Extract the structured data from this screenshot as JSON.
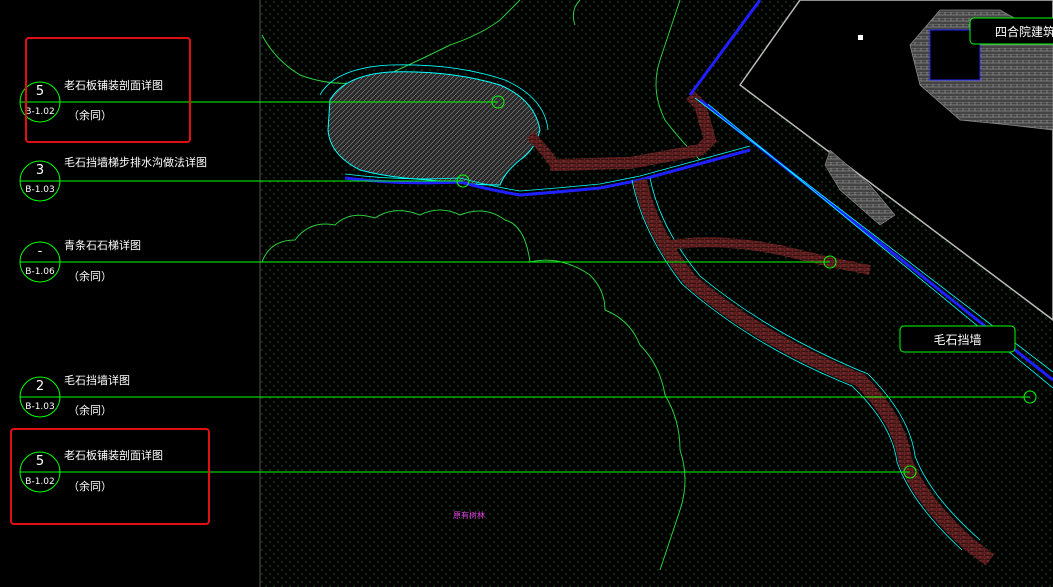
{
  "callouts": [
    {
      "number": "5",
      "sheet": "B-1.02",
      "title": "老石板铺装剖面详图",
      "note": "（余同）"
    },
    {
      "number": "3",
      "sheet": "B-1.03",
      "title": "毛石挡墙梯步排水沟做法详图",
      "note": ""
    },
    {
      "number": "-",
      "sheet": "B-1.06",
      "title": "青条石石梯详图",
      "note": "（余同）"
    },
    {
      "number": "2",
      "sheet": "B-1.03",
      "title": "毛石挡墙详图",
      "note": "（余同）"
    },
    {
      "number": "5",
      "sheet": "B-1.02",
      "title": "老石板铺装剖面详图",
      "note": "（余同）"
    }
  ],
  "tags": {
    "building": "四合院建筑",
    "wall": "毛石挡墙",
    "planting": "原有树林"
  },
  "colors": {
    "background": "#000000",
    "leader": "#00ff00",
    "path": "#00ffff",
    "highlight": "#e01010",
    "building": "#ffffff"
  }
}
